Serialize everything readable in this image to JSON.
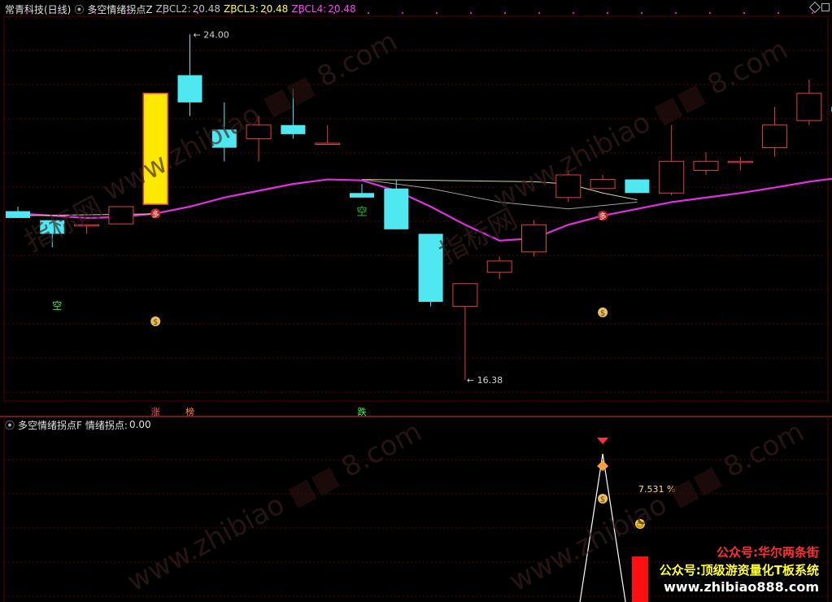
{
  "window": {
    "title": "常青科技(日线)"
  },
  "top_panel": {
    "indicator_name": "多空情绪拐点Z",
    "series": [
      {
        "label": "ZBCL2:",
        "value": "20.48",
        "color": "#c0c0c0"
      },
      {
        "label": "ZBCL3:",
        "value": "20.48",
        "color": "#ffff40"
      },
      {
        "label": "ZBCL4:",
        "value": "20.48",
        "color": "#ff40ff"
      }
    ],
    "high_marker": "24.00",
    "low_marker": "16.38",
    "kong_label": "空",
    "duo_label": "多",
    "money_icon_label": "$",
    "events": [
      "涨",
      "榜",
      "跌"
    ]
  },
  "bottom_panel": {
    "indicator_name": "多空情绪拐点F",
    "series_label": "情绪拐点:",
    "series_value": "0.00",
    "percent_label": "7.531 %"
  },
  "watermarks": {
    "site": "www.zhibiao",
    "site_suffix": "8.com",
    "cn": "指标网"
  },
  "promo": {
    "line1": "公众号:华尔两条街",
    "line2": "公众号:顶级游资量化T板系统",
    "line3": "www.zhibiao888.com"
  },
  "colors": {
    "up": "#e04040",
    "down": "#50e8f0",
    "ma_magenta": "#e030e0",
    "ma_yellow": "#d8d890",
    "ma_gray": "#a0a0a0",
    "grid": "#5a0000",
    "divider": "#a02020",
    "highlight": "#ffe800"
  },
  "chart_data": {
    "type": "candlestick",
    "y_range": [
      16.0,
      24.4
    ],
    "candles": [
      {
        "o": 20.1,
        "h": 20.2,
        "l": 19.95,
        "c": 19.95
      },
      {
        "o": 19.9,
        "h": 19.9,
        "l": 19.3,
        "c": 19.6
      },
      {
        "o": 19.8,
        "h": 19.8,
        "l": 19.6,
        "c": 19.8
      },
      {
        "o": 19.82,
        "h": 20.2,
        "l": 19.82,
        "c": 20.2
      },
      {
        "o": 20.25,
        "h": 22.7,
        "l": 20.25,
        "c": 22.7,
        "highlight": true
      },
      {
        "o": 23.1,
        "h": 24.0,
        "l": 22.2,
        "c": 22.5
      },
      {
        "o": 21.9,
        "h": 22.5,
        "l": 21.2,
        "c": 21.5
      },
      {
        "o": 21.7,
        "h": 22.2,
        "l": 21.2,
        "c": 22.0
      },
      {
        "o": 22.0,
        "h": 22.8,
        "l": 21.7,
        "c": 21.8
      },
      {
        "o": 21.6,
        "h": 22.0,
        "l": 21.6,
        "c": 21.6
      },
      {
        "o": 20.5,
        "h": 20.7,
        "l": 20.4,
        "c": 20.4
      },
      {
        "o": 20.6,
        "h": 20.8,
        "l": 19.7,
        "c": 19.7
      },
      {
        "o": 19.6,
        "h": 19.6,
        "l": 18.0,
        "c": 18.1
      },
      {
        "o": 18.0,
        "h": 18.1,
        "l": 16.38,
        "c": 18.5
      },
      {
        "o": 18.75,
        "h": 19.1,
        "l": 18.6,
        "c": 19.0
      },
      {
        "o": 19.2,
        "h": 19.9,
        "l": 19.1,
        "c": 19.8
      },
      {
        "o": 20.4,
        "h": 21.0,
        "l": 20.3,
        "c": 20.9
      },
      {
        "o": 20.6,
        "h": 20.9,
        "l": 20.6,
        "c": 20.8
      },
      {
        "o": 20.8,
        "h": 20.8,
        "l": 20.5,
        "c": 20.5
      },
      {
        "o": 20.5,
        "h": 22.0,
        "l": 20.45,
        "c": 21.2
      },
      {
        "o": 21.0,
        "h": 21.4,
        "l": 20.9,
        "c": 21.2
      },
      {
        "o": 21.2,
        "h": 21.3,
        "l": 21.0,
        "c": 21.2
      },
      {
        "o": 21.5,
        "h": 22.4,
        "l": 21.3,
        "c": 22.0
      },
      {
        "o": 22.1,
        "h": 23.0,
        "l": 22.0,
        "c": 22.7
      },
      {
        "o": 22.4,
        "h": 22.7,
        "l": 22.1,
        "c": 22.3
      }
    ],
    "ma_magenta": [
      20.05,
      20.0,
      19.95,
      19.97,
      20.05,
      20.2,
      20.4,
      20.55,
      20.7,
      20.8,
      20.78,
      20.55,
      20.2,
      19.8,
      19.45,
      19.5,
      19.8,
      20.0,
      20.15,
      20.3,
      20.4,
      20.5,
      20.62,
      20.75,
      20.85
    ],
    "ma_yellow_segment": [
      [
        10,
        20.8
      ],
      [
        15,
        20.75
      ],
      [
        16,
        20.7
      ],
      [
        17,
        20.5
      ],
      [
        18,
        20.35
      ]
    ],
    "ma_gray_segment": [
      [
        10,
        20.8
      ],
      [
        12,
        20.6
      ],
      [
        14,
        20.3
      ],
      [
        16,
        20.15
      ],
      [
        18,
        20.3
      ]
    ]
  }
}
